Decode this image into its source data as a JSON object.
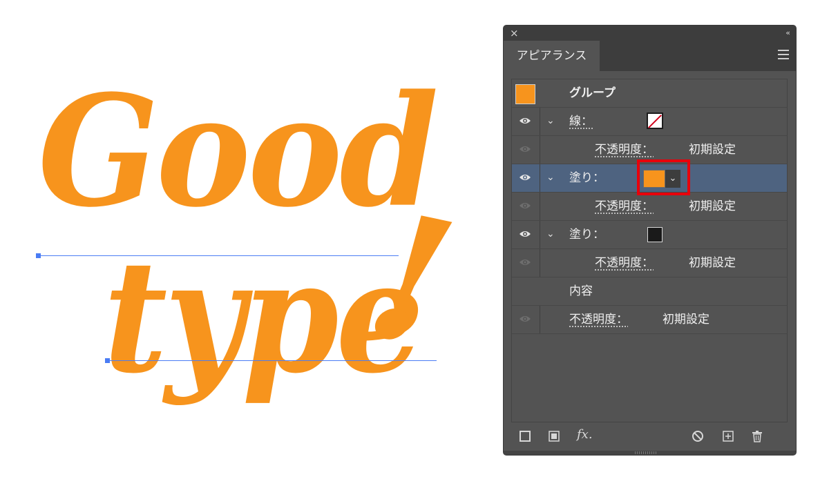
{
  "artwork": {
    "line1": "Good",
    "line2": "type",
    "exclamation": "!",
    "fill_color": "#f7941d"
  },
  "panel": {
    "close_glyph": "×",
    "collapse_glyph": "‹‹",
    "tab_label": "アピアランス",
    "rows": {
      "group": {
        "label": "グループ"
      },
      "stroke": {
        "label": "線："
      },
      "stroke_opacity": {
        "label": "不透明度：",
        "value": "初期設定"
      },
      "fill1": {
        "label": "塗り：",
        "dropdown_glyph": "⌄"
      },
      "fill1_opacity": {
        "label": "不透明度：",
        "value": "初期設定"
      },
      "fill2": {
        "label": "塗り："
      },
      "fill2_opacity": {
        "label": "不透明度：",
        "value": "初期設定"
      },
      "contents": {
        "label": "内容"
      },
      "opacity": {
        "label": "不透明度：",
        "value": "初期設定"
      }
    },
    "footer": {
      "fx_label": "fx."
    },
    "colors": {
      "panel_bg": "#535353",
      "selected_row": "#4e6380",
      "highlight": "#e8000b",
      "fill_orange": "#f7941d",
      "fill_black": "#1a1a1a"
    },
    "icons": [
      "close-icon",
      "collapse-icon",
      "panel-menu-icon",
      "eye-icon",
      "chevron-down-icon",
      "stroke-none-swatch",
      "add-stroke-icon",
      "add-fill-icon",
      "fx-icon",
      "clear-icon",
      "duplicate-icon",
      "trash-icon"
    ]
  }
}
